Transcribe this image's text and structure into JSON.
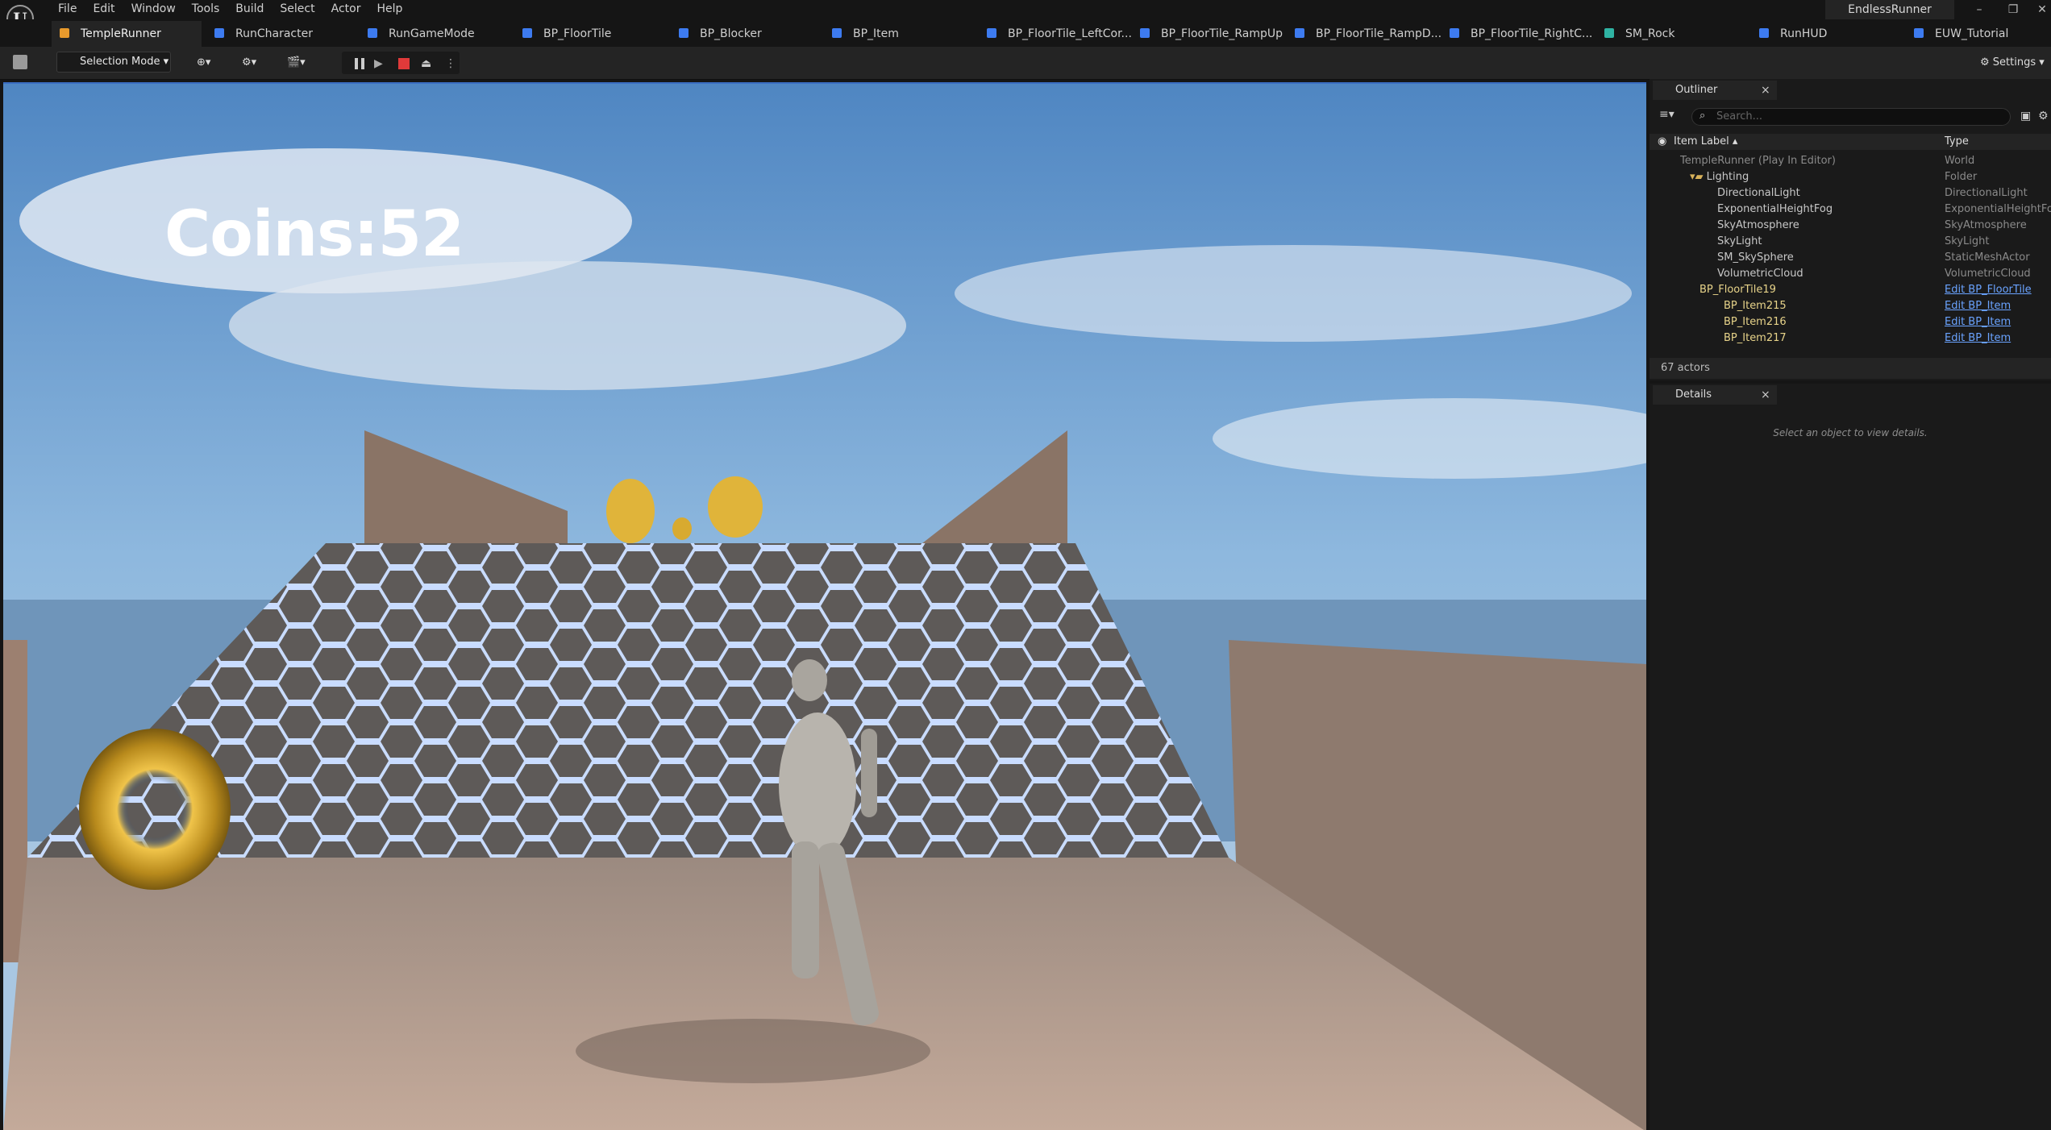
{
  "menu": {
    "items": [
      "File",
      "Edit",
      "Window",
      "Tools",
      "Build",
      "Select",
      "Actor",
      "Help"
    ],
    "project": "EndlessRunner"
  },
  "tabs": [
    {
      "label": "TempleRunner",
      "color": "#e89a2c"
    },
    {
      "label": "RunCharacter",
      "color": "#3d7bf0"
    },
    {
      "label": "RunGameMode",
      "color": "#3d7bf0"
    },
    {
      "label": "BP_FloorTile",
      "color": "#3d7bf0"
    },
    {
      "label": "BP_Blocker",
      "color": "#3d7bf0"
    },
    {
      "label": "BP_Item",
      "color": "#3d7bf0"
    },
    {
      "label": "BP_FloorTile_LeftCor...",
      "color": "#3d7bf0"
    },
    {
      "label": "BP_FloorTile_RampUp",
      "color": "#3d7bf0"
    },
    {
      "label": "BP_FloorTile_RampD...",
      "color": "#3d7bf0"
    },
    {
      "label": "BP_FloorTile_RightC...",
      "color": "#3d7bf0"
    },
    {
      "label": "SM_Rock",
      "color": "#2fb3a3"
    },
    {
      "label": "RunHUD",
      "color": "#3d7bf0"
    },
    {
      "label": "EUW_Tutorial",
      "color": "#3d7bf0"
    }
  ],
  "toolbar": {
    "selection_mode": "Selection Mode",
    "settings": "Settings"
  },
  "viewport": {
    "hud_text": "Coins:52"
  },
  "outliner": {
    "tab_label": "Outliner",
    "search_placeholder": "Search...",
    "col_label": "Item Label",
    "col_type": "Type",
    "rows": [
      {
        "label": "TempleRunner (Play In Editor)",
        "type": "World"
      },
      {
        "label": "Lighting",
        "type": "Folder"
      },
      {
        "label": "DirectionalLight",
        "type": "DirectionalLight"
      },
      {
        "label": "ExponentialHeightFog",
        "type": "ExponentialHeightFog"
      },
      {
        "label": "SkyAtmosphere",
        "type": "SkyAtmosphere"
      },
      {
        "label": "SkyLight",
        "type": "SkyLight"
      },
      {
        "label": "SM_SkySphere",
        "type": "StaticMeshActor"
      },
      {
        "label": "VolumetricCloud",
        "type": "VolumetricCloud"
      },
      {
        "label": "BP_FloorTile19",
        "type": "Edit BP_FloorTile"
      },
      {
        "label": "BP_Item215",
        "type": "Edit BP_Item"
      },
      {
        "label": "BP_Item216",
        "type": "Edit BP_Item"
      },
      {
        "label": "BP_Item217",
        "type": "Edit BP_Item"
      }
    ],
    "actor_count": "67 actors"
  },
  "details": {
    "tab_label": "Details",
    "empty_message": "Select an object to view details."
  }
}
